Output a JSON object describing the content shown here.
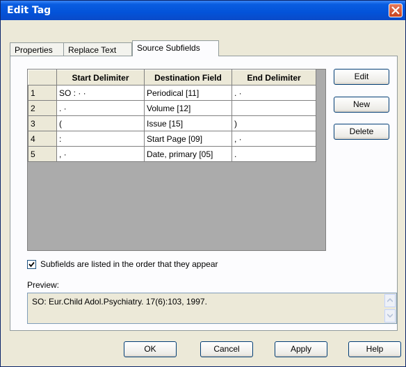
{
  "window": {
    "title": "Edit Tag"
  },
  "tabs": [
    {
      "label": "Properties"
    },
    {
      "label": "Replace Text"
    },
    {
      "label": "Source Subfields"
    }
  ],
  "grid": {
    "headers": {
      "start": "Start Delimiter",
      "dest": "Destination Field",
      "end": "End Delimiter"
    },
    "rows": [
      {
        "num": "1",
        "start": "SO : · ·",
        "dest": "Periodical [11]",
        "end": ". ·"
      },
      {
        "num": "2",
        "start": ". ·",
        "dest": "Volume [12]",
        "end": ""
      },
      {
        "num": "3",
        "start": "(",
        "dest": "Issue [15]",
        "end": ")"
      },
      {
        "num": "4",
        "start": ":",
        "dest": "Start Page [09]",
        "end": ", ·"
      },
      {
        "num": "5",
        "start": ", ·",
        "dest": "Date, primary [05]",
        "end": "."
      }
    ]
  },
  "side_buttons": {
    "edit": "Edit",
    "new": "New",
    "delete": "Delete"
  },
  "order_checkbox": {
    "label": "Subfields are listed in the order that they appear",
    "checked": true
  },
  "preview": {
    "label": "Preview:",
    "text": "SO:  Eur.Child Adol.Psychiatry. 17(6):103, 1997."
  },
  "footer_buttons": {
    "ok": "OK",
    "cancel": "Cancel",
    "apply": "Apply",
    "help": "Help"
  }
}
